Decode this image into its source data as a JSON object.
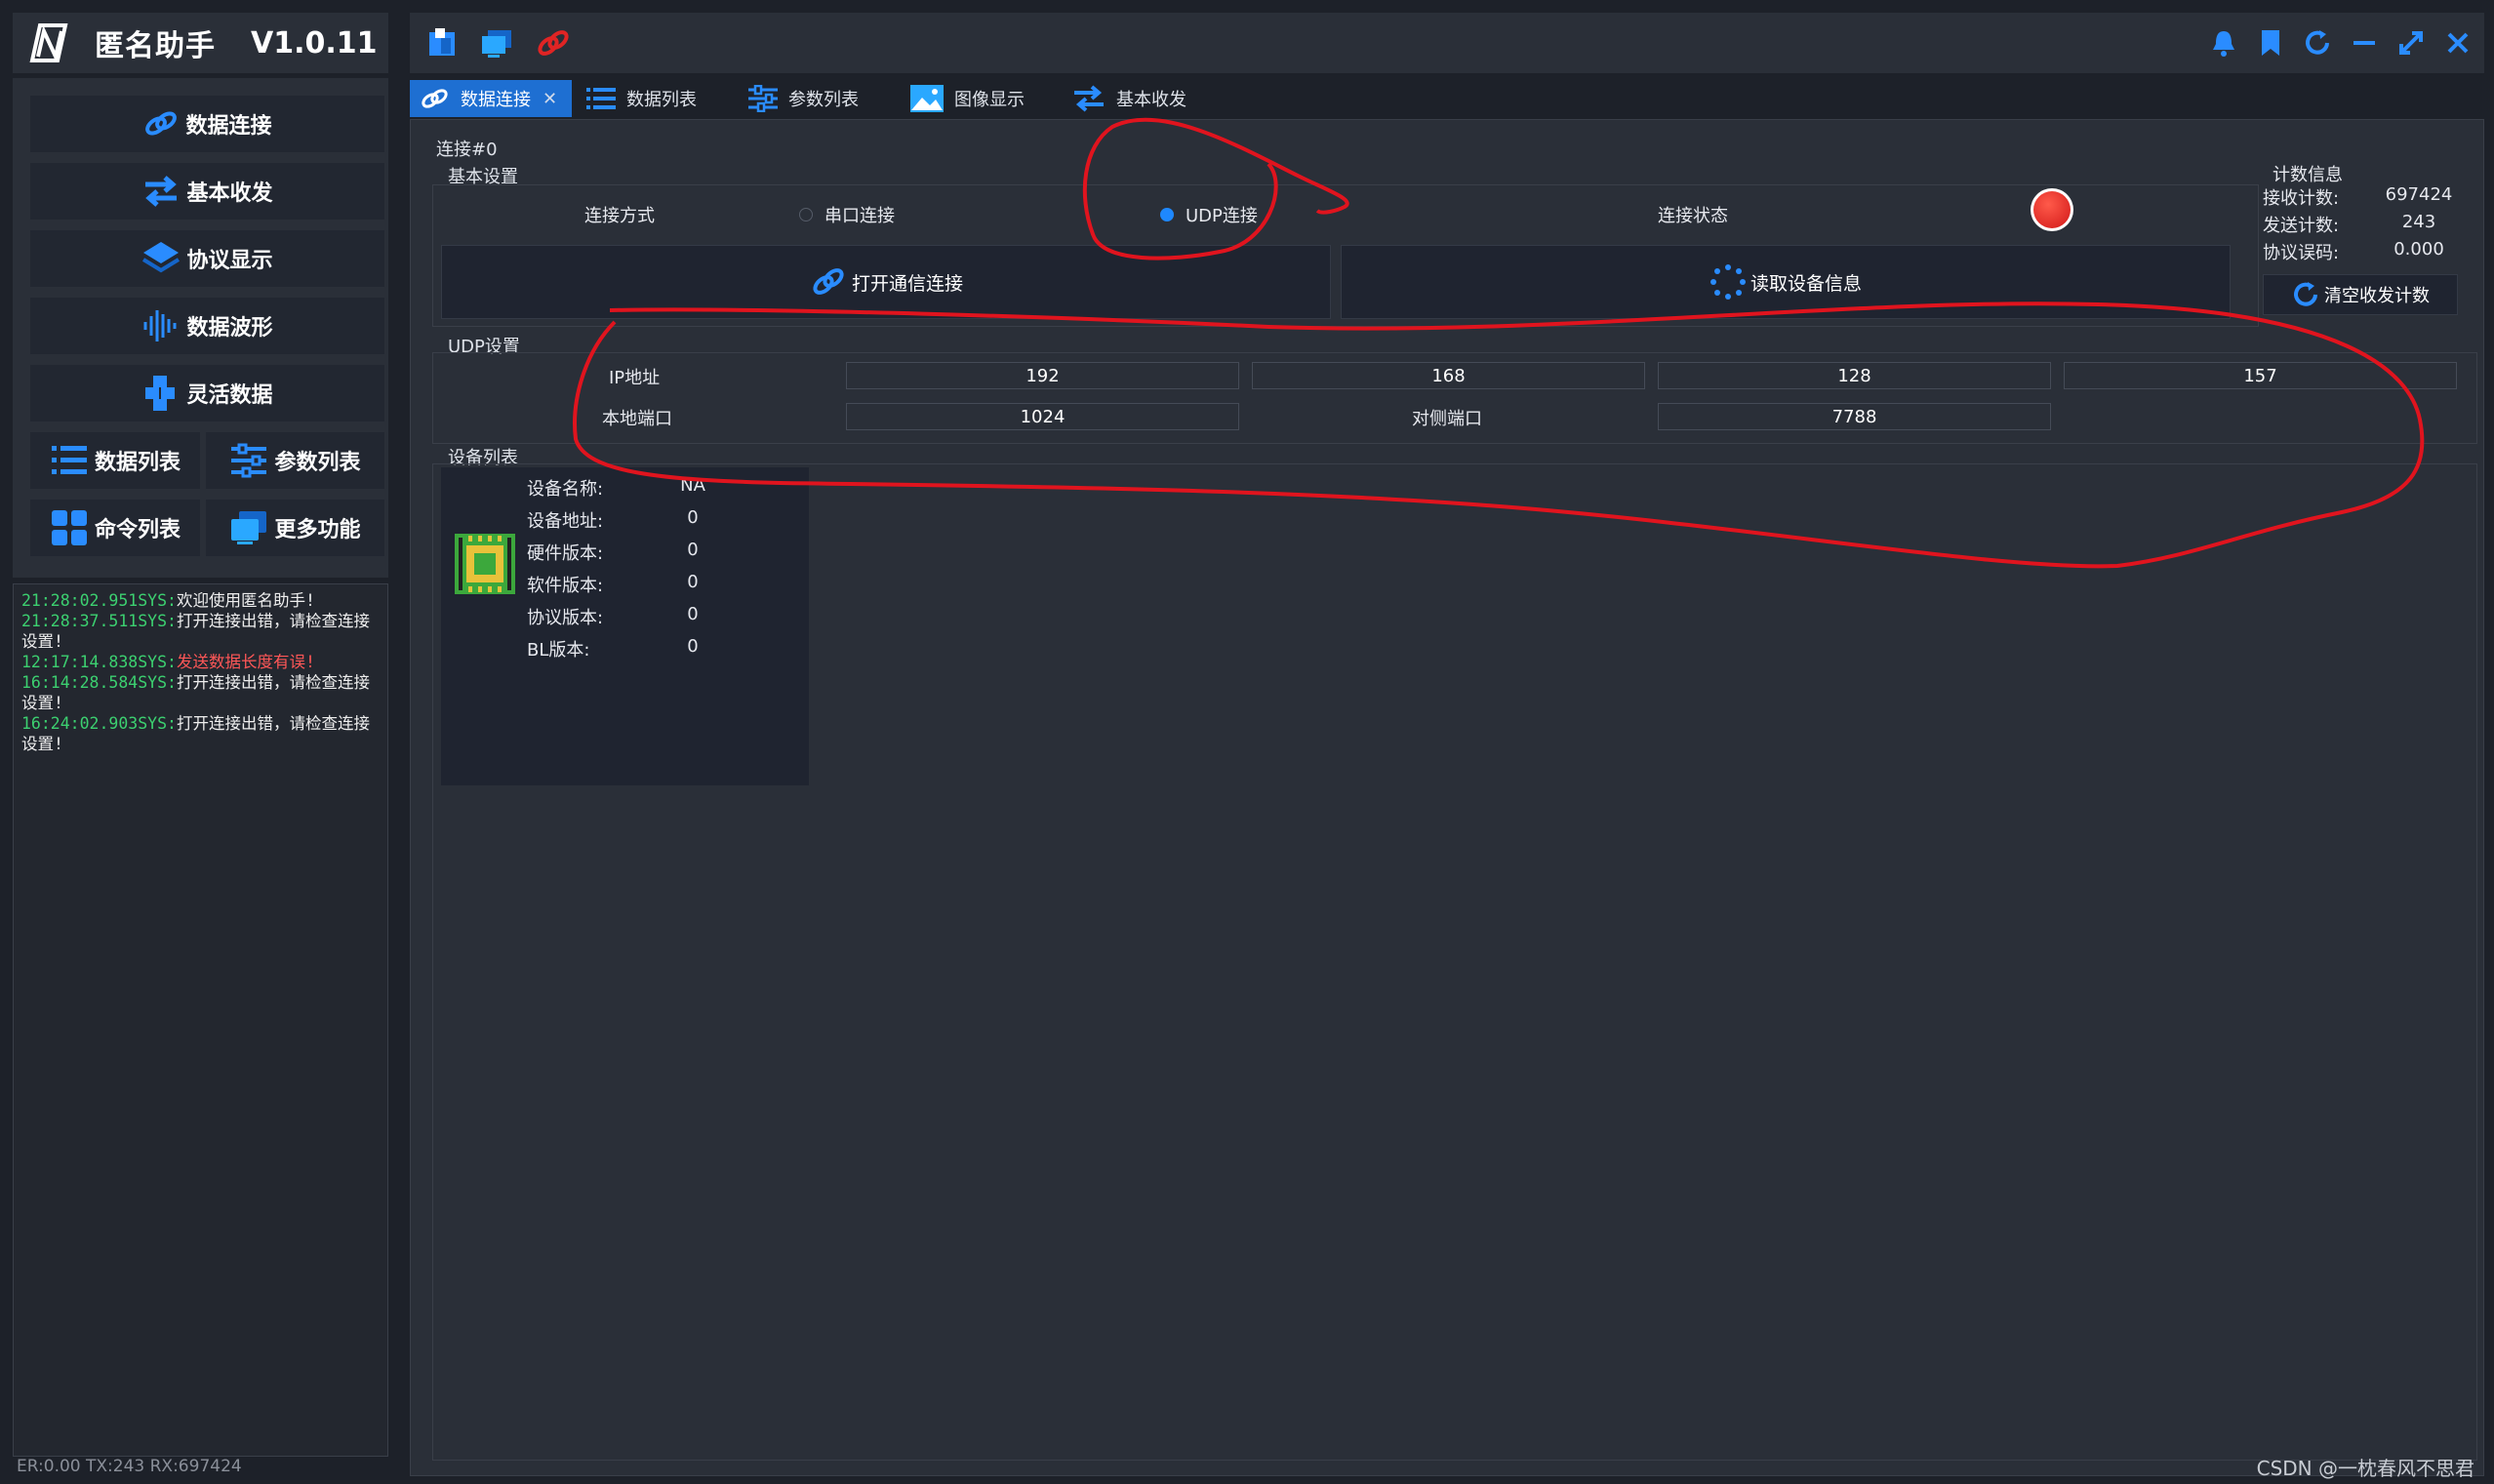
{
  "app": {
    "title": "匿名助手",
    "version": "V1.0.11"
  },
  "sidebar": {
    "items": [
      {
        "label": "数据连接",
        "icon": "link-icon"
      },
      {
        "label": "基本收发",
        "icon": "transfer-icon"
      },
      {
        "label": "协议显示",
        "icon": "layers-icon"
      },
      {
        "label": "数据波形",
        "icon": "waveform-icon"
      },
      {
        "label": "灵活数据",
        "icon": "cubes-icon"
      },
      {
        "label": "数据列表",
        "icon": "list-icon"
      },
      {
        "label": "参数列表",
        "icon": "sliders-icon"
      },
      {
        "label": "命令列表",
        "icon": "grid-icon"
      },
      {
        "label": "更多功能",
        "icon": "windows-icon"
      }
    ]
  },
  "log": [
    {
      "ts": "21:28:02.951SYS:",
      "msg": "欢迎使用匿名助手!",
      "error": false
    },
    {
      "ts": "21:28:37.511SYS:",
      "msg": "打开连接出错，请检查连接设置!",
      "error": false
    },
    {
      "ts": "12:17:14.838SYS:",
      "msg": "发送数据长度有误!",
      "error": true
    },
    {
      "ts": "16:14:28.584SYS:",
      "msg": "打开连接出错，请检查连接设置!",
      "error": false
    },
    {
      "ts": "16:24:02.903SYS:",
      "msg": "打开连接出错，请检查连接设置!",
      "error": false
    }
  ],
  "status_line": "ER:0.00 TX:243 RX:697424",
  "tabs": [
    {
      "label": "数据连接",
      "active": true,
      "closable": true
    },
    {
      "label": "数据列表",
      "active": false
    },
    {
      "label": "参数列表",
      "active": false
    },
    {
      "label": "图像显示",
      "active": false
    },
    {
      "label": "基本收发",
      "active": false
    }
  ],
  "connection": {
    "group_title": "连接#0",
    "basic": {
      "title": "基本设置",
      "mode_label": "连接方式",
      "serial_option": "串口连接",
      "udp_option": "UDP连接",
      "selected": "UDP连接",
      "status_label": "连接状态",
      "status_color": "#e02020",
      "open_button": "打开通信连接",
      "read_button": "读取设备信息"
    },
    "udp": {
      "title": "UDP设置",
      "ip_label": "IP地址",
      "ip": [
        "192",
        "168",
        "128",
        "157"
      ],
      "local_port_label": "本地端口",
      "local_port": "1024",
      "remote_port_label": "对侧端口",
      "remote_port": "7788"
    },
    "counters": {
      "title": "计数信息",
      "rx_label": "接收计数:",
      "rx": "697424",
      "tx_label": "发送计数:",
      "tx": "243",
      "err_label": "协议误码:",
      "err": "0.000",
      "clear_button": "清空收发计数"
    },
    "devices": {
      "title": "设备列表",
      "fields": [
        {
          "label": "设备名称:",
          "value": "NA"
        },
        {
          "label": "设备地址:",
          "value": "0"
        },
        {
          "label": "硬件版本:",
          "value": "0"
        },
        {
          "label": "软件版本:",
          "value": "0"
        },
        {
          "label": "协议版本:",
          "value": "0"
        },
        {
          "label": "BL版本:",
          "value": "0"
        }
      ]
    }
  },
  "watermark": "CSDN @一枕春风不思君",
  "colors": {
    "accent": "#1e6fd2",
    "icon_blue": "#2a8cff",
    "annotation_red": "#e0141e"
  }
}
